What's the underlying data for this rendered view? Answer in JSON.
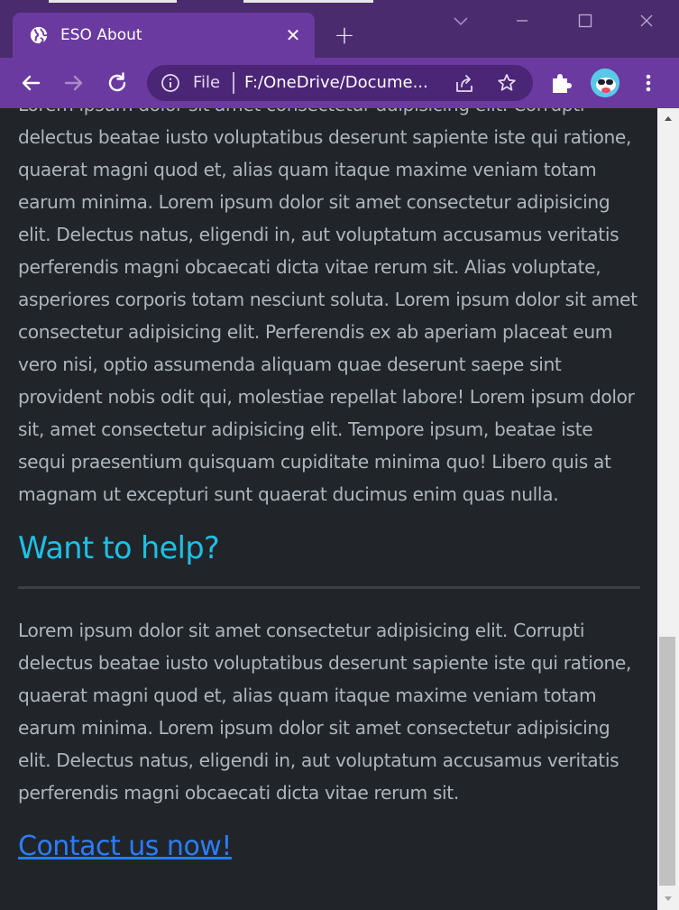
{
  "window": {
    "tab_title": "ESO About",
    "tab_close_glyph": "✕",
    "new_tab_glyph": "+",
    "icons": [
      "globe-icon",
      "chevron-down-icon",
      "minimize-icon",
      "maximize-icon",
      "close-icon"
    ]
  },
  "toolbar": {
    "icons": [
      "back-arrow-icon",
      "forward-arrow-icon",
      "reload-icon",
      "info-icon",
      "share-icon",
      "star-icon",
      "puzzle-icon",
      "kebab-menu-icon"
    ],
    "omnibox": {
      "scheme_label": "File",
      "url": "F:/OneDrive/Docume..."
    }
  },
  "colors": {
    "frame": "#4a2b6e",
    "tab_active": "#6b3aa0",
    "page_bg": "#212529",
    "text": "#adb5bd",
    "heading": "#1ec0e4",
    "link": "#2a7dff"
  },
  "page": {
    "intro_paragraph": "Lorem ipsum dolor sit amet consectetur adipisicing elit. Corrupti delectus beatae iusto voluptatibus deserunt sapiente iste qui ratione, quaerat magni quod et, alias quam itaque maxime veniam totam earum minima. Lorem ipsum dolor sit amet consectetur adipisicing elit. Delectus natus, eligendi in, aut voluptatum accusamus veritatis perferendis magni obcaecati dicta vitae rerum sit. Alias voluptate, asperiores corporis totam nesciunt soluta. Lorem ipsum dolor sit amet consectetur adipisicing elit. Perferendis ex ab aperiam placeat eum vero nisi, optio assumenda aliquam quae deserunt saepe sint provident nobis odit qui, molestiae repellat labore! Lorem ipsum dolor sit, amet consectetur adipisicing elit. Tempore ipsum, beatae iste sequi praesentium quisquam cupiditate minima quo! Libero quis at magnam ut excepturi sunt quaerat ducimus enim quas nulla.",
    "help_heading": "Want to help?",
    "help_paragraph": "Lorem ipsum dolor sit amet consectetur adipisicing elit. Corrupti delectus beatae iusto voluptatibus deserunt sapiente iste qui ratione, quaerat magni quod et, alias quam itaque maxime veniam totam earum minima. Lorem ipsum dolor sit amet consectetur adipisicing elit. Delectus natus, eligendi in, aut voluptatum accusamus veritatis perferendis magni obcaecati dicta vitae rerum sit.",
    "contact_link": "Contact us now!"
  }
}
